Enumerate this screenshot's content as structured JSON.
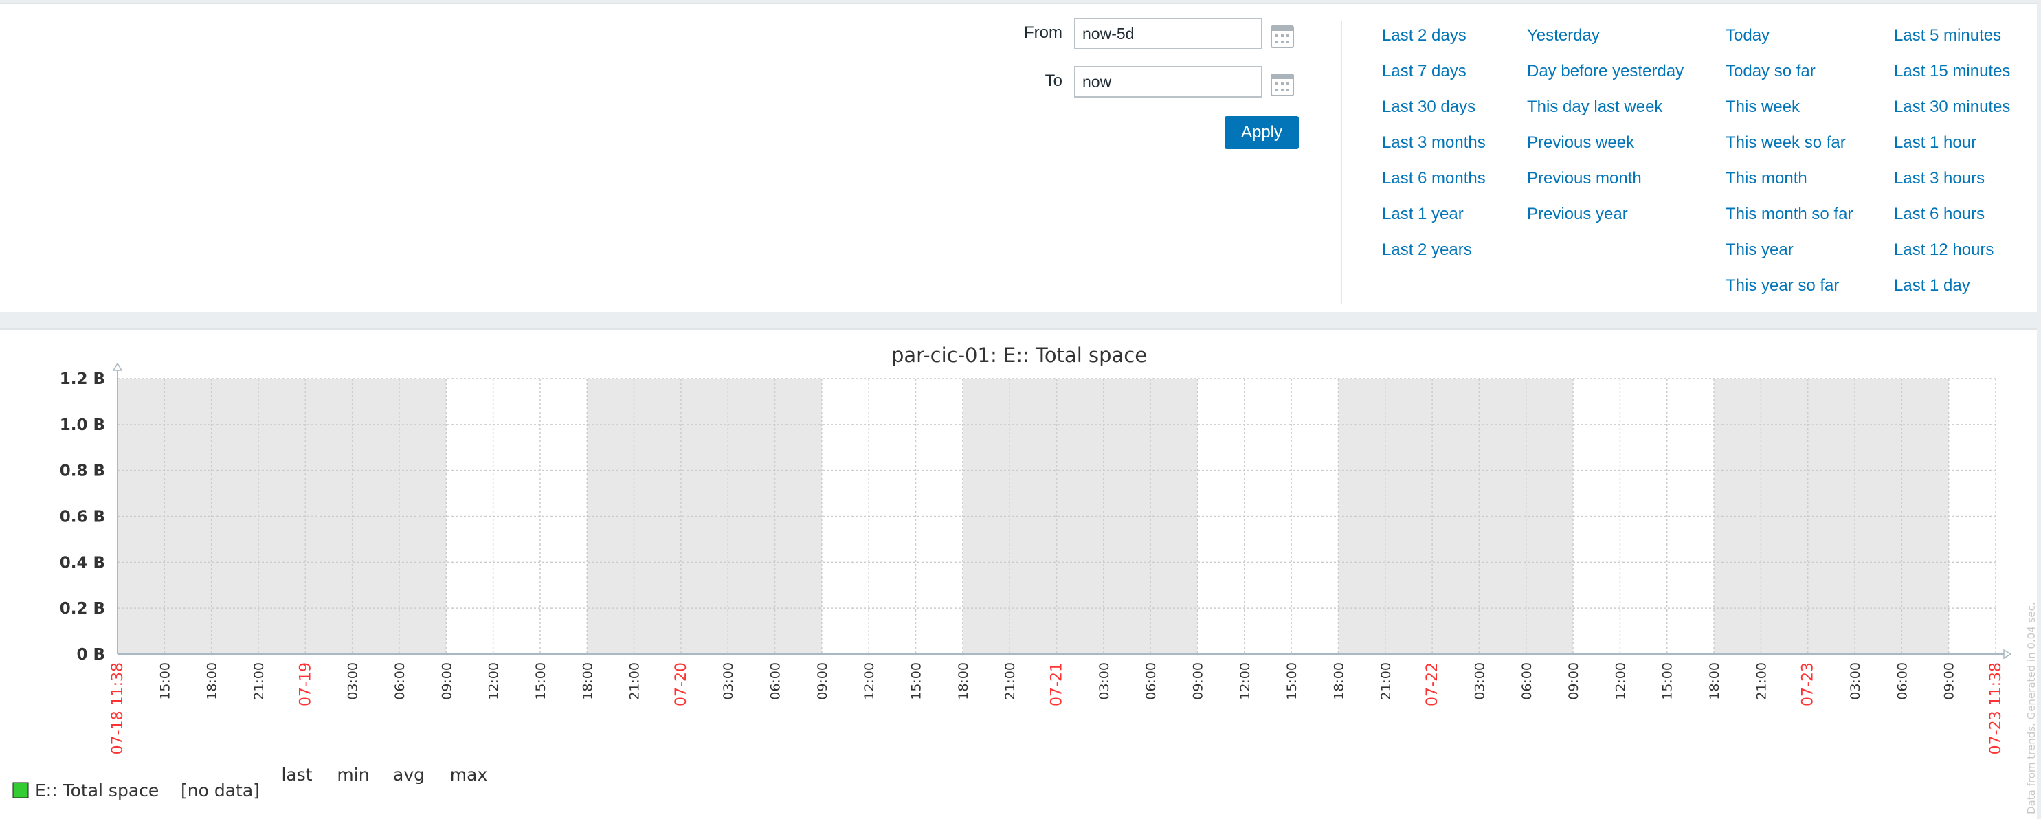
{
  "time_filter": {
    "from_label": "From",
    "from_value": "now-5d",
    "to_label": "To",
    "to_value": "now",
    "apply_label": "Apply",
    "quick_ranges": [
      [
        "Last 2 days",
        "Last 7 days",
        "Last 30 days",
        "Last 3 months",
        "Last 6 months",
        "Last 1 year",
        "Last 2 years"
      ],
      [
        "Yesterday",
        "Day before yesterday",
        "This day last week",
        "Previous week",
        "Previous month",
        "Previous year"
      ],
      [
        "Today",
        "Today so far",
        "This week",
        "This week so far",
        "This month",
        "This month so far",
        "This year",
        "This year so far"
      ],
      [
        "Last 5 minutes",
        "Last 15 minutes",
        "Last 30 minutes",
        "Last 1 hour",
        "Last 3 hours",
        "Last 6 hours",
        "Last 12 hours",
        "Last 1 day"
      ]
    ]
  },
  "graph": {
    "title": "par-cic-01: E:: Total space",
    "y_ticks": [
      "0 B",
      "0.2 B",
      "0.4 B",
      "0.6 B",
      "0.8 B",
      "1.0 B",
      "1.2 B"
    ],
    "x_ticks": [
      {
        "label": "07-18 11:38",
        "highlight": true
      },
      {
        "label": "15:00"
      },
      {
        "label": "18:00"
      },
      {
        "label": "21:00"
      },
      {
        "label": "07-19",
        "highlight": true
      },
      {
        "label": "03:00"
      },
      {
        "label": "06:00"
      },
      {
        "label": "09:00"
      },
      {
        "label": "12:00"
      },
      {
        "label": "15:00"
      },
      {
        "label": "18:00"
      },
      {
        "label": "21:00"
      },
      {
        "label": "07-20",
        "highlight": true
      },
      {
        "label": "03:00"
      },
      {
        "label": "06:00"
      },
      {
        "label": "09:00"
      },
      {
        "label": "12:00"
      },
      {
        "label": "15:00"
      },
      {
        "label": "18:00"
      },
      {
        "label": "21:00"
      },
      {
        "label": "07-21",
        "highlight": true
      },
      {
        "label": "03:00"
      },
      {
        "label": "06:00"
      },
      {
        "label": "09:00"
      },
      {
        "label": "12:00"
      },
      {
        "label": "15:00"
      },
      {
        "label": "18:00"
      },
      {
        "label": "21:00"
      },
      {
        "label": "07-22",
        "highlight": true
      },
      {
        "label": "03:00"
      },
      {
        "label": "06:00"
      },
      {
        "label": "09:00"
      },
      {
        "label": "12:00"
      },
      {
        "label": "15:00"
      },
      {
        "label": "18:00"
      },
      {
        "label": "21:00"
      },
      {
        "label": "07-23",
        "highlight": true
      },
      {
        "label": "03:00"
      },
      {
        "label": "06:00"
      },
      {
        "label": "09:00"
      },
      {
        "label": "07-23 11:38",
        "highlight": true
      }
    ],
    "legend": {
      "headers": [
        "last",
        "min",
        "avg",
        "max"
      ],
      "item_name": "E:: Total space",
      "item_value": "[no data]",
      "item_color": "#33cc33"
    },
    "side_note": "Data from trends. Generated in 0.04 sec.",
    "colors": {
      "shade": "#e8e8e8",
      "grid": "#cccccc",
      "axis": "#a9b8c3",
      "tick_label": "#333333",
      "tick_highlight": "#ff3333"
    }
  },
  "chart_data": {
    "type": "line",
    "title": "par-cic-01: E:: Total space",
    "x_range": [
      "07-18 11:38",
      "07-23 11:38"
    ],
    "ylim": [
      0,
      1.2
    ],
    "y_unit": "B",
    "series": [
      {
        "name": "E:: Total space",
        "values": []
      }
    ],
    "grid": true,
    "legend_position": "bottom-left"
  }
}
